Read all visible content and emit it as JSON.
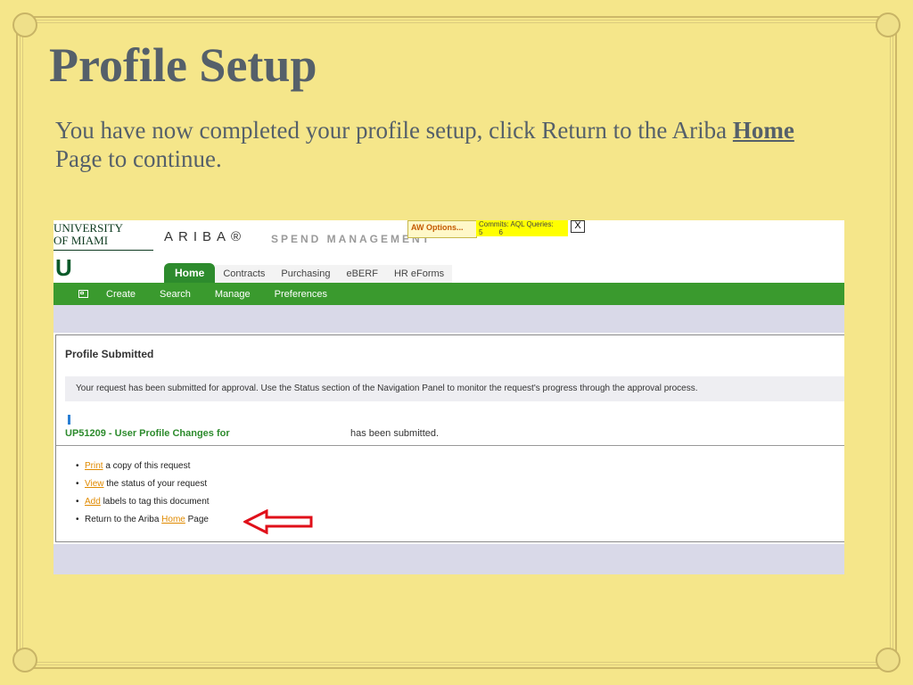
{
  "slide": {
    "title": "Profile Setup",
    "text_before": "You have now completed your profile setup, click Return to the Ariba ",
    "home_word": "Home",
    "text_after": " Page to continue."
  },
  "header": {
    "univ_line1": "UNIVERSITY",
    "univ_line2": "OF MIAMI",
    "logo_letter": "U",
    "ariba_logo": "ARIBA®",
    "spend_text": "SPEND MANAGEMENT",
    "aw_options": "AW Options...",
    "commits_label": "Commits: AQL Queries:",
    "commits_value": "5",
    "queries_value": "6",
    "close_label": "X"
  },
  "tabs": [
    {
      "label": "Home",
      "active": true
    },
    {
      "label": "Contracts",
      "active": false
    },
    {
      "label": "Purchasing",
      "active": false
    },
    {
      "label": "eBERF",
      "active": false
    },
    {
      "label": "HR eForms",
      "active": false
    }
  ],
  "navbar": {
    "items": [
      "Create",
      "Search",
      "Manage",
      "Preferences"
    ]
  },
  "panel": {
    "title": "Profile Submitted",
    "message": "Your request has been submitted for approval. Use the Status section of the Navigation Panel to monitor the request's progress through the approval process.",
    "record": "UP51209 - User Profile Changes for",
    "submitted": "has been submitted.",
    "actions": [
      {
        "link": "Print",
        "rest": " a copy of this request"
      },
      {
        "link": "View",
        "rest": " the status of your request"
      },
      {
        "link": "Add",
        "rest": " labels to tag this document"
      },
      {
        "prefix": "Return to the Ariba ",
        "link": "Home",
        "rest": " Page"
      }
    ]
  },
  "colors": {
    "slide_bg": "#f5e68a",
    "title_text": "#55606a",
    "ariba_green": "#3a9a2e",
    "link_orange": "#e08a00",
    "arrow_red": "#e0101a"
  }
}
